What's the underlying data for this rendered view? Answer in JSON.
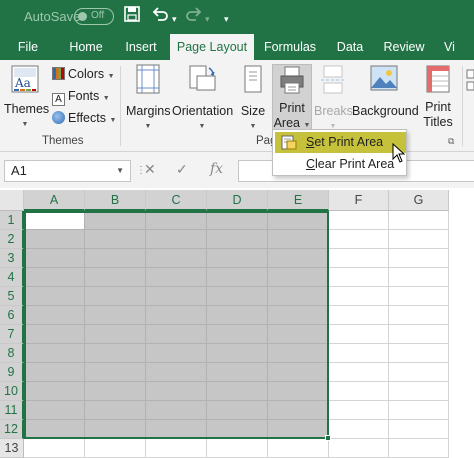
{
  "titlebar": {
    "autosave_label": "AutoSave",
    "autosave_state": "Off"
  },
  "tabs": [
    {
      "label": "File",
      "active": false
    },
    {
      "label": "Home",
      "active": false
    },
    {
      "label": "Insert",
      "active": false
    },
    {
      "label": "Page Layout",
      "active": true
    },
    {
      "label": "Formulas",
      "active": false
    },
    {
      "label": "Data",
      "active": false
    },
    {
      "label": "Review",
      "active": false
    },
    {
      "label": "Vi",
      "active": false
    }
  ],
  "ribbon": {
    "themes_label": "Themes",
    "colors_label": "Colors",
    "fonts_label": "Fonts",
    "effects_label": "Effects",
    "themes_group": "Themes",
    "margins_label": "Margins",
    "orientation_label": "Orientation",
    "size_label": "Size",
    "print_area_label_1": "Print",
    "print_area_label_2": "Area",
    "breaks_label": "Breaks",
    "background_label": "Background",
    "print_titles_label_1": "Print",
    "print_titles_label_2": "Titles",
    "page_setup_group_partial": "Pag"
  },
  "formula_bar": {
    "name_box": "A1",
    "cancel_icon": "✕",
    "enter_icon": "✓",
    "fx_icon": "fx",
    "formula": ""
  },
  "columns": [
    "A",
    "B",
    "C",
    "D",
    "E",
    "F",
    "G"
  ],
  "rows": [
    "1",
    "2",
    "3",
    "4",
    "5",
    "6",
    "7",
    "8",
    "9",
    "10",
    "11",
    "12",
    "13"
  ],
  "selection": {
    "range": "A1:E12"
  },
  "dropdown": {
    "items": [
      {
        "label": "Set Print Area",
        "hover": true
      },
      {
        "label": "Clear Print Area",
        "hover": false
      }
    ]
  },
  "colors": {
    "excel_green": "#217346",
    "hover": "#c5c13a",
    "selection_fill": "#c6c6c6"
  }
}
